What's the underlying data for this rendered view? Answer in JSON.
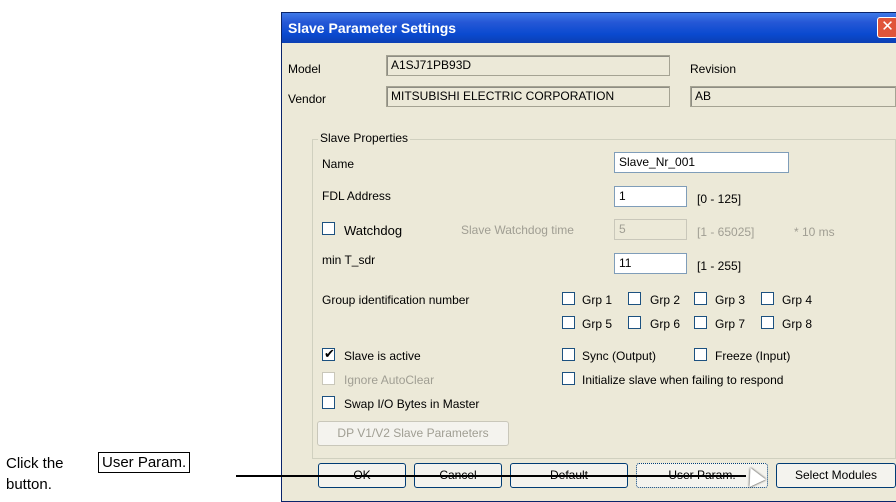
{
  "dialog": {
    "title": "Slave Parameter Settings",
    "close_label": "✕",
    "model_label": "Model",
    "model_value": "A1SJ71PB93D",
    "revision_label": "Revision",
    "vendor_label": "Vendor",
    "vendor_value": "MITSUBISHI ELECTRIC CORPORATION",
    "revision_value": "AB"
  },
  "slave_properties": {
    "legend": "Slave Properties",
    "name_label": "Name",
    "name_value": "Slave_Nr_001",
    "fdl_label": "FDL Address",
    "fdl_value": "1",
    "fdl_range": "[0 - 125]",
    "watchdog_label": "Watchdog",
    "watchdog_checked": false,
    "watchdog_time_label": "Slave Watchdog time",
    "watchdog_time_value": "5",
    "watchdog_time_range": "[1 - 65025]",
    "watchdog_time_unit": "* 10 ms",
    "min_tsdr_label": "min T_sdr",
    "min_tsdr_value": "11",
    "min_tsdr_range": "[1 - 255]",
    "group_label": "Group identification number",
    "groups": [
      "Grp 1",
      "Grp 2",
      "Grp 3",
      "Grp 4",
      "Grp 5",
      "Grp 6",
      "Grp 7",
      "Grp 8"
    ],
    "slave_active_label": "Slave is active",
    "slave_active_checked": true,
    "sync_label": "Sync (Output)",
    "freeze_label": "Freeze (Input)",
    "ignore_autoclear_label": "Ignore AutoClear",
    "init_slave_label": "Initialize slave when failing to respond",
    "swap_io_label": "Swap I/O Bytes in Master",
    "dpv1_button_label": "DP V1/V2 Slave Parameters"
  },
  "buttons": {
    "ok": "OK",
    "cancel": "Cancel",
    "default": "Default",
    "user_param": "User Param.",
    "select_modules": "Select Modules"
  },
  "hint": {
    "prefix": "Click the",
    "boxed": "User Param.",
    "suffix": "button."
  }
}
